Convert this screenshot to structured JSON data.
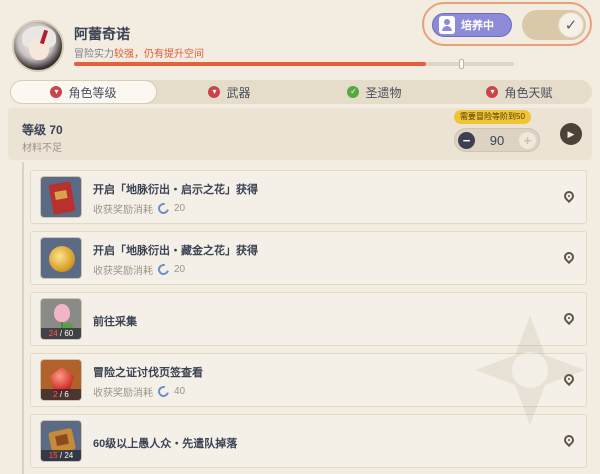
{
  "character": {
    "name": "阿蕾奇诺",
    "adventure_prefix": "冒险实力",
    "adventure_status": "较强，仍有提升空间",
    "progress": 0.8
  },
  "training": {
    "badge_label": "培养中",
    "toggle_on": true
  },
  "tabs": [
    {
      "label": "角色等级",
      "active": true,
      "dot_color": "#c9444b"
    },
    {
      "label": "武器",
      "active": false,
      "dot_color": "#c9444b"
    },
    {
      "label": "圣遗物",
      "active": false,
      "dot_color": "#57a83f"
    },
    {
      "label": "角色天赋",
      "active": false,
      "dot_color": "#c9444b"
    }
  ],
  "level": {
    "title": "等级 70",
    "subtitle": "材料不足",
    "hint": "需要冒险等阶到50",
    "target": "90",
    "minus": "−",
    "plus": "+"
  },
  "tasks": [
    {
      "title": "开启「地脉衍出・启示之花」获得",
      "cost_label": "收获奖励消耗",
      "cost": "20",
      "icon": "book-icon",
      "count": ""
    },
    {
      "title": "开启「地脉衍出・藏金之花」获得",
      "cost_label": "收获奖励消耗",
      "cost": "20",
      "icon": "coin-icon",
      "count": ""
    },
    {
      "title": "前往采集",
      "cost_label": "",
      "cost": "",
      "icon": "flower-icon",
      "count_have": "24",
      "count_need": "60"
    },
    {
      "title": "冒险之证讨伐页签查看",
      "cost_label": "收获奖励消耗",
      "cost": "40",
      "icon": "gem-icon",
      "count_have": "2",
      "count_need": "6"
    },
    {
      "title": "60级以上愚人众・先遣队掉落",
      "cost_label": "",
      "cost": "",
      "icon": "box-icon",
      "count_have": "15",
      "count_need": "24"
    }
  ],
  "colors": {
    "accent": "#e4603e",
    "badge": "#8d8bd8",
    "hint": "#f1c434"
  }
}
